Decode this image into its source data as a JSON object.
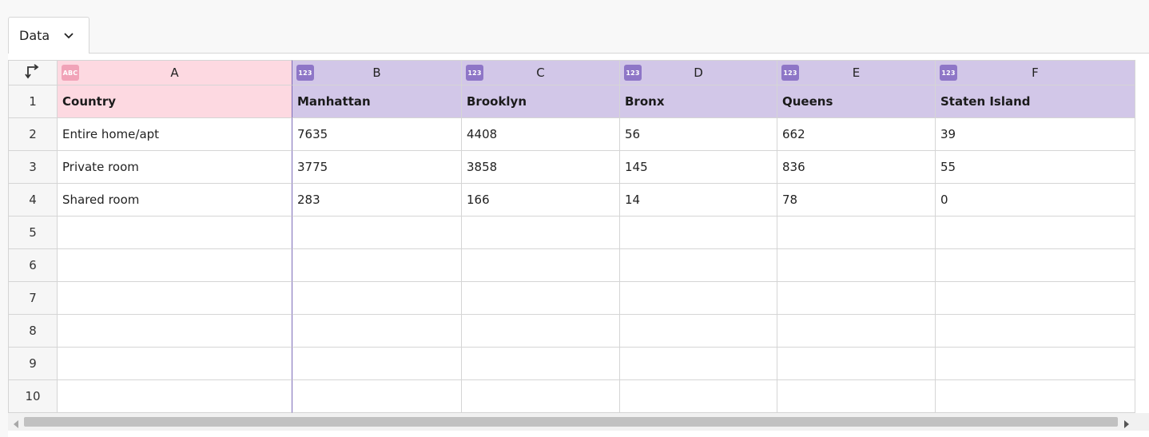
{
  "tab": {
    "label": "Data",
    "icon": "chevron-down-icon"
  },
  "corner_icon": "transpose-icon",
  "columns": [
    {
      "letter": "A",
      "type_badge": "ABC"
    },
    {
      "letter": "B",
      "type_badge": "123"
    },
    {
      "letter": "C",
      "type_badge": "123"
    },
    {
      "letter": "D",
      "type_badge": "123"
    },
    {
      "letter": "E",
      "type_badge": "123"
    },
    {
      "letter": "F",
      "type_badge": "123"
    }
  ],
  "row_numbers": [
    "1",
    "2",
    "3",
    "4",
    "5",
    "6",
    "7",
    "8",
    "9",
    "10"
  ],
  "rows": [
    [
      "Country",
      "Manhattan",
      "Brooklyn",
      "Bronx",
      "Queens",
      "Staten Island"
    ],
    [
      "Entire home/apt",
      "7635",
      "4408",
      "56",
      "662",
      "39"
    ],
    [
      "Private room",
      "3775",
      "3858",
      "145",
      "836",
      "55"
    ],
    [
      "Shared room",
      "283",
      "166",
      "14",
      "78",
      "0"
    ],
    [
      "",
      "",
      "",
      "",
      "",
      ""
    ],
    [
      "",
      "",
      "",
      "",
      "",
      ""
    ],
    [
      "",
      "",
      "",
      "",
      "",
      ""
    ],
    [
      "",
      "",
      "",
      "",
      "",
      ""
    ],
    [
      "",
      "",
      "",
      "",
      "",
      ""
    ],
    [
      "",
      "",
      "",
      "",
      "",
      ""
    ]
  ],
  "colors": {
    "text_column_accent": "#fdd9e1",
    "text_badge": "#f1a3b8",
    "number_column_accent": "#d2c7e8",
    "number_badge": "#8e76c7"
  }
}
